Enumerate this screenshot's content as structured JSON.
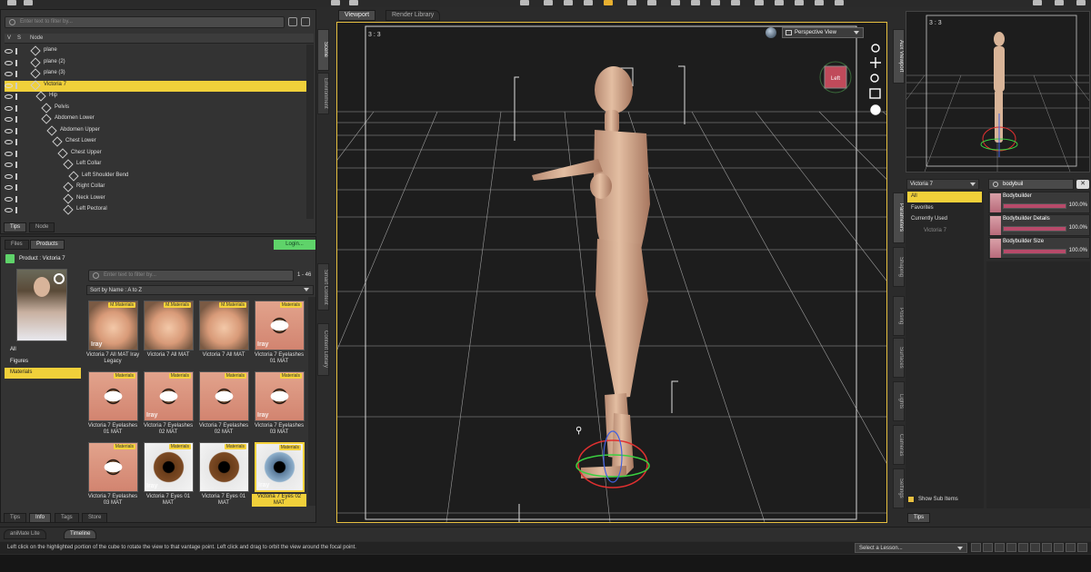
{
  "scene": {
    "filter_placeholder": "Enter text to filter by...",
    "columns": {
      "v": "V",
      "s": "S",
      "node": "Node"
    },
    "nodes": [
      {
        "label": "plane",
        "indent": 0
      },
      {
        "label": "plane (2)",
        "indent": 0
      },
      {
        "label": "plane (3)",
        "indent": 0
      },
      {
        "label": "Victoria 7",
        "indent": 0,
        "selected": true
      },
      {
        "label": "Hip",
        "indent": 1
      },
      {
        "label": "Pelvis",
        "indent": 2
      },
      {
        "label": "Abdomen Lower",
        "indent": 2
      },
      {
        "label": "Abdomen Upper",
        "indent": 3
      },
      {
        "label": "Chest Lower",
        "indent": 4
      },
      {
        "label": "Chest Upper",
        "indent": 5
      },
      {
        "label": "Left Collar",
        "indent": 6
      },
      {
        "label": "Left Shoulder Bend",
        "indent": 7
      },
      {
        "label": "Right Collar",
        "indent": 6
      },
      {
        "label": "Neck Lower",
        "indent": 6
      },
      {
        "label": "Left Pectoral",
        "indent": 6
      }
    ],
    "bottom_tabs": [
      "Tips",
      "Node"
    ]
  },
  "side_tabs_left": [
    "Scene",
    "Environment",
    "Smart Content",
    "Content Library"
  ],
  "content": {
    "tabs": [
      "Files",
      "Products"
    ],
    "login_label": "Login...",
    "product_label": "Product : Victoria 7",
    "filter_placeholder": "Enter text to filter by...",
    "count": "1 - 46",
    "sort_label": "Sort by Name : A to Z",
    "categories": [
      {
        "label": "All",
        "selected": false
      },
      {
        "label": "Figures",
        "selected": false
      },
      {
        "label": "Materials",
        "selected": true
      }
    ],
    "items": [
      {
        "tag": "M.Materials",
        "type": "face",
        "caption": "Victoria 7 All MAT Iray Legacy",
        "badge": "Iray"
      },
      {
        "tag": "M.Materials",
        "type": "face",
        "caption": "Victoria 7 All MAT",
        "badge": ""
      },
      {
        "tag": "M.Materials",
        "type": "face",
        "caption": "Victoria 7 All MAT",
        "badge": ""
      },
      {
        "tag": "Materials",
        "type": "eye1",
        "caption": "Victoria 7 Eyelashes 01 MAT",
        "badge": "Iray"
      },
      {
        "tag": "Materials",
        "type": "eye1",
        "caption": "Victoria 7 Eyelashes 01 MAT",
        "badge": ""
      },
      {
        "tag": "Materials",
        "type": "eye1",
        "caption": "Victoria 7 Eyelashes 02 MAT",
        "badge": "Iray"
      },
      {
        "tag": "Materials",
        "type": "eye1",
        "caption": "Victoria 7 Eyelashes 02 MAT",
        "badge": ""
      },
      {
        "tag": "Materials",
        "type": "eye1",
        "caption": "Victoria 7 Eyelashes 03 MAT",
        "badge": "Iray"
      },
      {
        "tag": "Materials",
        "type": "eye1",
        "caption": "Victoria 7 Eyelashes 03 MAT",
        "badge": ""
      },
      {
        "tag": "Materials",
        "type": "eye2",
        "caption": "Victoria 7 Eyes 01 MAT",
        "badge": "Iray"
      },
      {
        "tag": "Materials",
        "type": "eye2",
        "caption": "Victoria 7 Eyes 01 MAT",
        "badge": ""
      },
      {
        "tag": "Materials",
        "type": "eye3",
        "caption": "Victoria 7 Eyes 02 MAT",
        "badge": "Iray",
        "selected": true
      }
    ],
    "bottom_tabs": [
      "Tips",
      "Info",
      "Tags",
      "Store"
    ]
  },
  "viewport": {
    "tabs": [
      "Viewport",
      "Render Library"
    ],
    "aspect": "3 : 3",
    "view_label": "Perspective View",
    "cube_label": "Left"
  },
  "aux": {
    "aspect": "3 : 3",
    "side_tab": "Aux Viewport"
  },
  "parameters": {
    "node_select": "Victoria 7",
    "search_value": "bodybuil",
    "groups": [
      {
        "label": "All",
        "selected": true
      },
      {
        "label": "Favorites",
        "selected": false
      },
      {
        "label": "Currently Used",
        "selected": false
      },
      {
        "label": "Victoria 7",
        "selected": false
      }
    ],
    "props": [
      {
        "label": "Bodybuilder",
        "value": "100.0%",
        "level": 1.0
      },
      {
        "label": "Bodybuilder Details",
        "value": "100.0%",
        "level": 1.0
      },
      {
        "label": "Bodybuilder Size",
        "value": "100.0%",
        "level": 1.0
      }
    ],
    "show_sub_items": "Show Sub Items",
    "side_tabs": [
      "Parameters",
      "Shaping",
      "Posing",
      "Surfaces",
      "Lights",
      "Cameras",
      "Settings"
    ],
    "tips_tab": "Tips"
  },
  "bottom": {
    "tabs": [
      "aniMate Lite",
      "Timeline"
    ],
    "status_text": "Left click on the highlighted portion of the cube to rotate the view to that vantage point. Left click and drag to orbit the view around the focal point.",
    "lesson_select": "Select a Lesson..."
  },
  "colors": {
    "accent_yellow": "#f0d03a",
    "login_green": "#5fd36a",
    "slider_pink": "#b84a6a"
  }
}
